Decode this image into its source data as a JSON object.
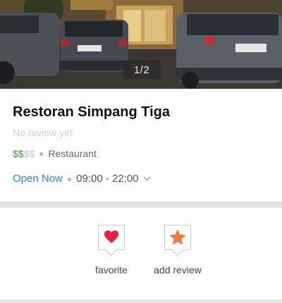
{
  "gallery": {
    "counter": "1/2",
    "icon": "photo-gallery"
  },
  "place": {
    "name": "Restoran Simpang Tiga",
    "review_status": "No review yet",
    "price_active": "$$",
    "price_inactive": "$$",
    "category": "Restaurant",
    "open_status": "Open Now",
    "hours": "09:00 - 22:00"
  },
  "actions": [
    {
      "label": "favorite",
      "icon": "heart-icon"
    },
    {
      "label": "add review",
      "icon": "star-icon"
    }
  ],
  "colors": {
    "price_active": "#2e9e3e",
    "open_now": "#2a86d8",
    "heart": "#e8233a",
    "star": "#f2773a"
  }
}
